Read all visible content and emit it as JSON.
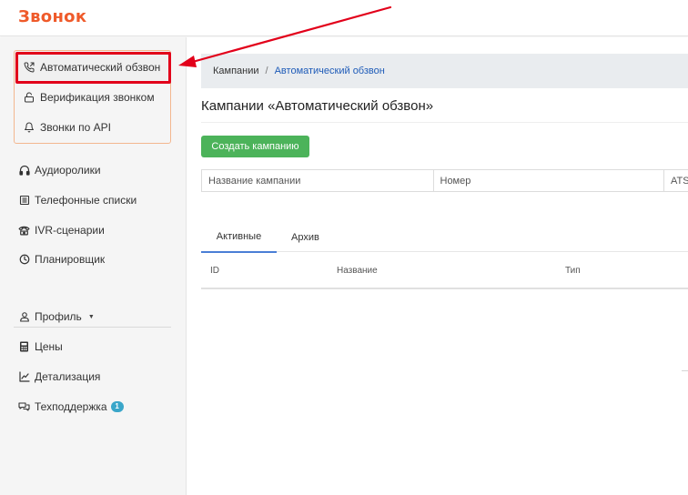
{
  "header": {
    "logo_text": "Звонок",
    "brand_color": "#ef5a2a"
  },
  "sidebar": {
    "submenu": [
      {
        "label": "Автоматический обзвон",
        "icon": "phone-outgoing-icon",
        "active": true
      },
      {
        "label": "Верификация звонком",
        "icon": "unlock-icon"
      },
      {
        "label": "Звонки по API",
        "icon": "bell-icon"
      }
    ],
    "items": [
      {
        "label": "Аудиоролики",
        "icon": "headphones-icon"
      },
      {
        "label": "Телефонные списки",
        "icon": "list-icon"
      },
      {
        "label": "IVR-сценарии",
        "icon": "telephone-icon"
      },
      {
        "label": "Планировщик",
        "icon": "clock-icon"
      }
    ],
    "account": [
      {
        "label": "Профиль",
        "icon": "user-icon"
      },
      {
        "label": "Цены",
        "icon": "calculator-icon"
      },
      {
        "label": "Детализация",
        "icon": "chart-line-icon"
      },
      {
        "label": "Техподдержка",
        "icon": "chat-icon",
        "badge": "1"
      }
    ]
  },
  "breadcrumb": {
    "root": "Кампании",
    "separator": "/",
    "current": "Автоматический обзвон"
  },
  "page": {
    "title": "Кампании «Автоматический обзвон»",
    "create_button": "Создать кампанию"
  },
  "filters": {
    "name_placeholder": "Название кампании",
    "number_placeholder": "Номер",
    "ats_placeholder": "ATS"
  },
  "tabs": [
    {
      "label": "Активные",
      "active": true
    },
    {
      "label": "Архив"
    }
  ],
  "table": {
    "columns": [
      "ID",
      "Название",
      "Тип"
    ]
  },
  "colors": {
    "accent": "#4a7ed6",
    "success": "#4cb35a",
    "highlight": "#e2001a",
    "badge": "#3aa6c9"
  }
}
